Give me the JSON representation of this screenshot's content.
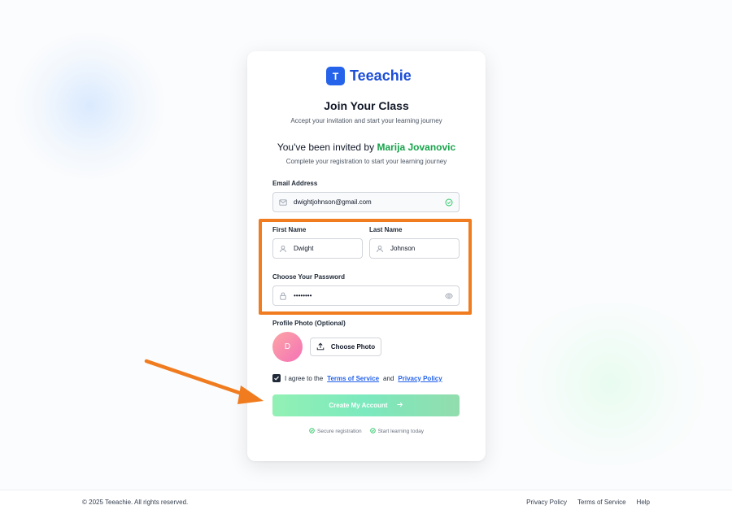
{
  "brand": {
    "logo_letter": "T",
    "name": "Teeachie",
    "color": "#2563eb"
  },
  "header": {
    "title": "Join Your Class",
    "subtitle": "Accept your invitation and start your learning journey"
  },
  "invite": {
    "prefix": "You've been invited by",
    "inviter": "Marija Jovanovic",
    "subtitle": "Complete your registration to start your learning journey"
  },
  "form": {
    "email_label": "Email Address",
    "email_value": "dwightjohnson@gmail.com",
    "first_name_label": "First Name",
    "first_name_value": "Dwight",
    "last_name_label": "Last Name",
    "last_name_value": "Johnson",
    "password_label": "Choose Your Password",
    "password_value": "••••••••",
    "photo_label": "Profile Photo (Optional)",
    "avatar_initial": "D",
    "choose_photo_label": "Choose Photo",
    "agree_prefix": "I agree to the",
    "terms_link": "Terms of Service",
    "agree_and": "and",
    "privacy_link": "Privacy Policy",
    "agree_checked": true,
    "submit_label": "Create My Account"
  },
  "footnotes": [
    "Secure registration",
    "Start learning today"
  ],
  "footer": {
    "copyright": "© 2025 Teeachie. All rights reserved.",
    "links": [
      "Privacy Policy",
      "Terms of Service",
      "Help"
    ]
  },
  "colors": {
    "accent_green": "#16a34a",
    "annotation_orange": "#f07c1f",
    "submit_green": "#86efac"
  },
  "icons": {
    "email": "mail-icon",
    "valid": "check-circle-icon",
    "first_name": "user-icon",
    "last_name": "user-icon",
    "password": "lock-icon",
    "reveal": "eye-icon",
    "upload": "upload-icon",
    "submit": "arrow-right-icon"
  }
}
